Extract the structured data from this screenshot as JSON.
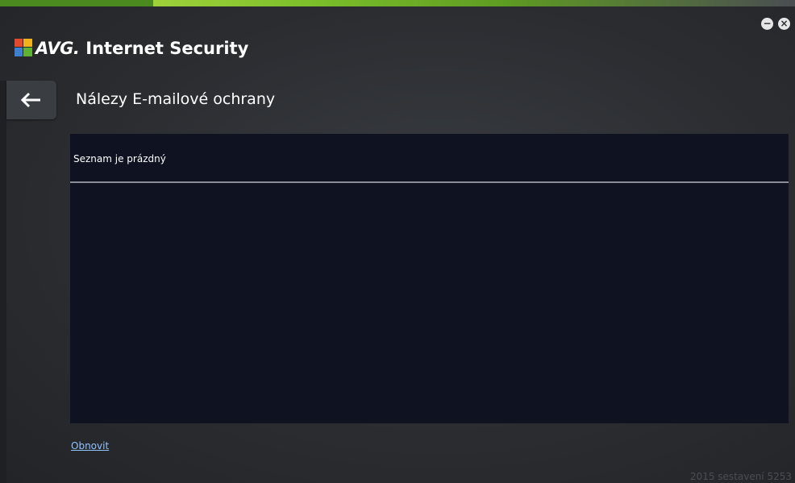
{
  "app": {
    "brand": "AVG.",
    "product": "Internet Security"
  },
  "window_controls": {
    "minimize_symbol": "−",
    "close_symbol": "×"
  },
  "page": {
    "title": "Nálezy E-mailové ochrany"
  },
  "list": {
    "empty_message": "Seznam je prázdný"
  },
  "footer": {
    "refresh_label": "Obnovit",
    "build_info": "2015  sestavení 5253"
  },
  "icons": {
    "logo": "avg-logo-icon",
    "back": "arrow-left-icon",
    "minimize": "minimize-icon",
    "close": "close-icon"
  },
  "colors": {
    "accent_green": "#7bbf2a",
    "panel_bg": "#0e1221",
    "link": "#8fc3ff"
  }
}
